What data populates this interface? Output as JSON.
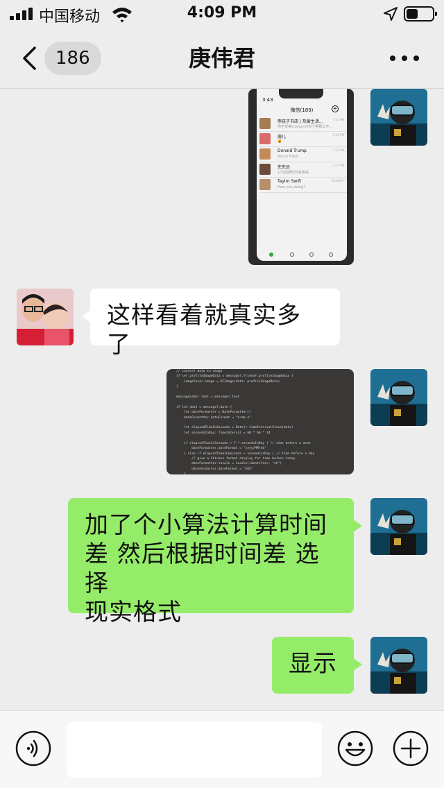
{
  "status_bar": {
    "carrier": "中国移动",
    "time": "4:09 PM"
  },
  "nav": {
    "unread_count": "186",
    "title": "庚伟君",
    "back_icon": "chevron-left-icon",
    "more_icon": "more-dots-icon"
  },
  "messages": [
    {
      "id": "m1",
      "sender": "self",
      "type": "image",
      "image": {
        "kind": "phone-screenshot",
        "time": "3:43",
        "title": "微信(189)",
        "rows": [
          {
            "name": "熊孩子书店 | 热爱生活...",
            "preview": "你不觉得chang-chi你了啊那么不...",
            "time": "3:42 PM"
          },
          {
            "name": "庚儿",
            "preview": "🍯",
            "time": "3:25 PM"
          },
          {
            "name": "Donald Trump",
            "preview": "You're Fired!",
            "time": "3:17 PM"
          },
          {
            "name": "先先员",
            "preview": "公元前那时代变换是",
            "time": "3:17 PM"
          },
          {
            "name": "Taylor Swift",
            "preview": "How you doing?",
            "time": "2019/8/7"
          }
        ]
      }
    },
    {
      "id": "m2",
      "sender": "other",
      "type": "text",
      "text": "这样看着就真实多了"
    },
    {
      "id": "m3",
      "sender": "self",
      "type": "image",
      "image": {
        "kind": "code-photo",
        "code_lines": [
          "// convert data to image",
          "if let profileImageData = message?.friend?.profileImageData {",
          "    imageCover.image = UIImage(data: profileImageData)",
          "}",
          "",
          "messageLabel.text = message?.text",
          "",
          "if let date = message?.date {",
          "    let dateFormatter = DateFormatter()",
          "    dateFormatter.dateFormat = \"h:mm a\"",
          "",
          "    let elapsedTimeInSeconds = Date().timeIntervalSince(date)",
          "    let secondsInDay: TimeInterval = 60 * 60 * 24",
          "",
          "    if elapsedTimeInSeconds > 7 * secondsInDay { // time before a week",
          "        dateFormatter.dateFormat = \"yyyy/MM/dd\"",
          "    } else if elapsedTimeInSeconds > secondsInDay { // time before a day",
          "        // give a Chinese format display for time before today",
          "        dateFormatter.locale = Locale(identifier: \"zh\")",
          "        dateFormatter.dateFormat = \"EEE\"",
          "    }",
          "",
          "    dateLabel.text = dateFormatter.string(from: date)",
          "}",
          "    }",
          "}",
          "",
          "// UI elements"
        ]
      }
    },
    {
      "id": "m4",
      "sender": "self",
      "type": "text",
      "lines": [
        "加了个小算法计算时间",
        "差 然后根据时间差 选择",
        "现实格式"
      ]
    },
    {
      "id": "m5",
      "sender": "self",
      "type": "text",
      "text": "显示"
    }
  ],
  "input_bar": {
    "voice_icon": "voice-icon",
    "input_value": "",
    "emoji_icon": "emoji-icon",
    "add_icon": "add-icon"
  },
  "colors": {
    "background": "#ededed",
    "bubble_self": "#95ec69",
    "bubble_other": "#ffffff",
    "input_bar": "#f7f7f7"
  }
}
